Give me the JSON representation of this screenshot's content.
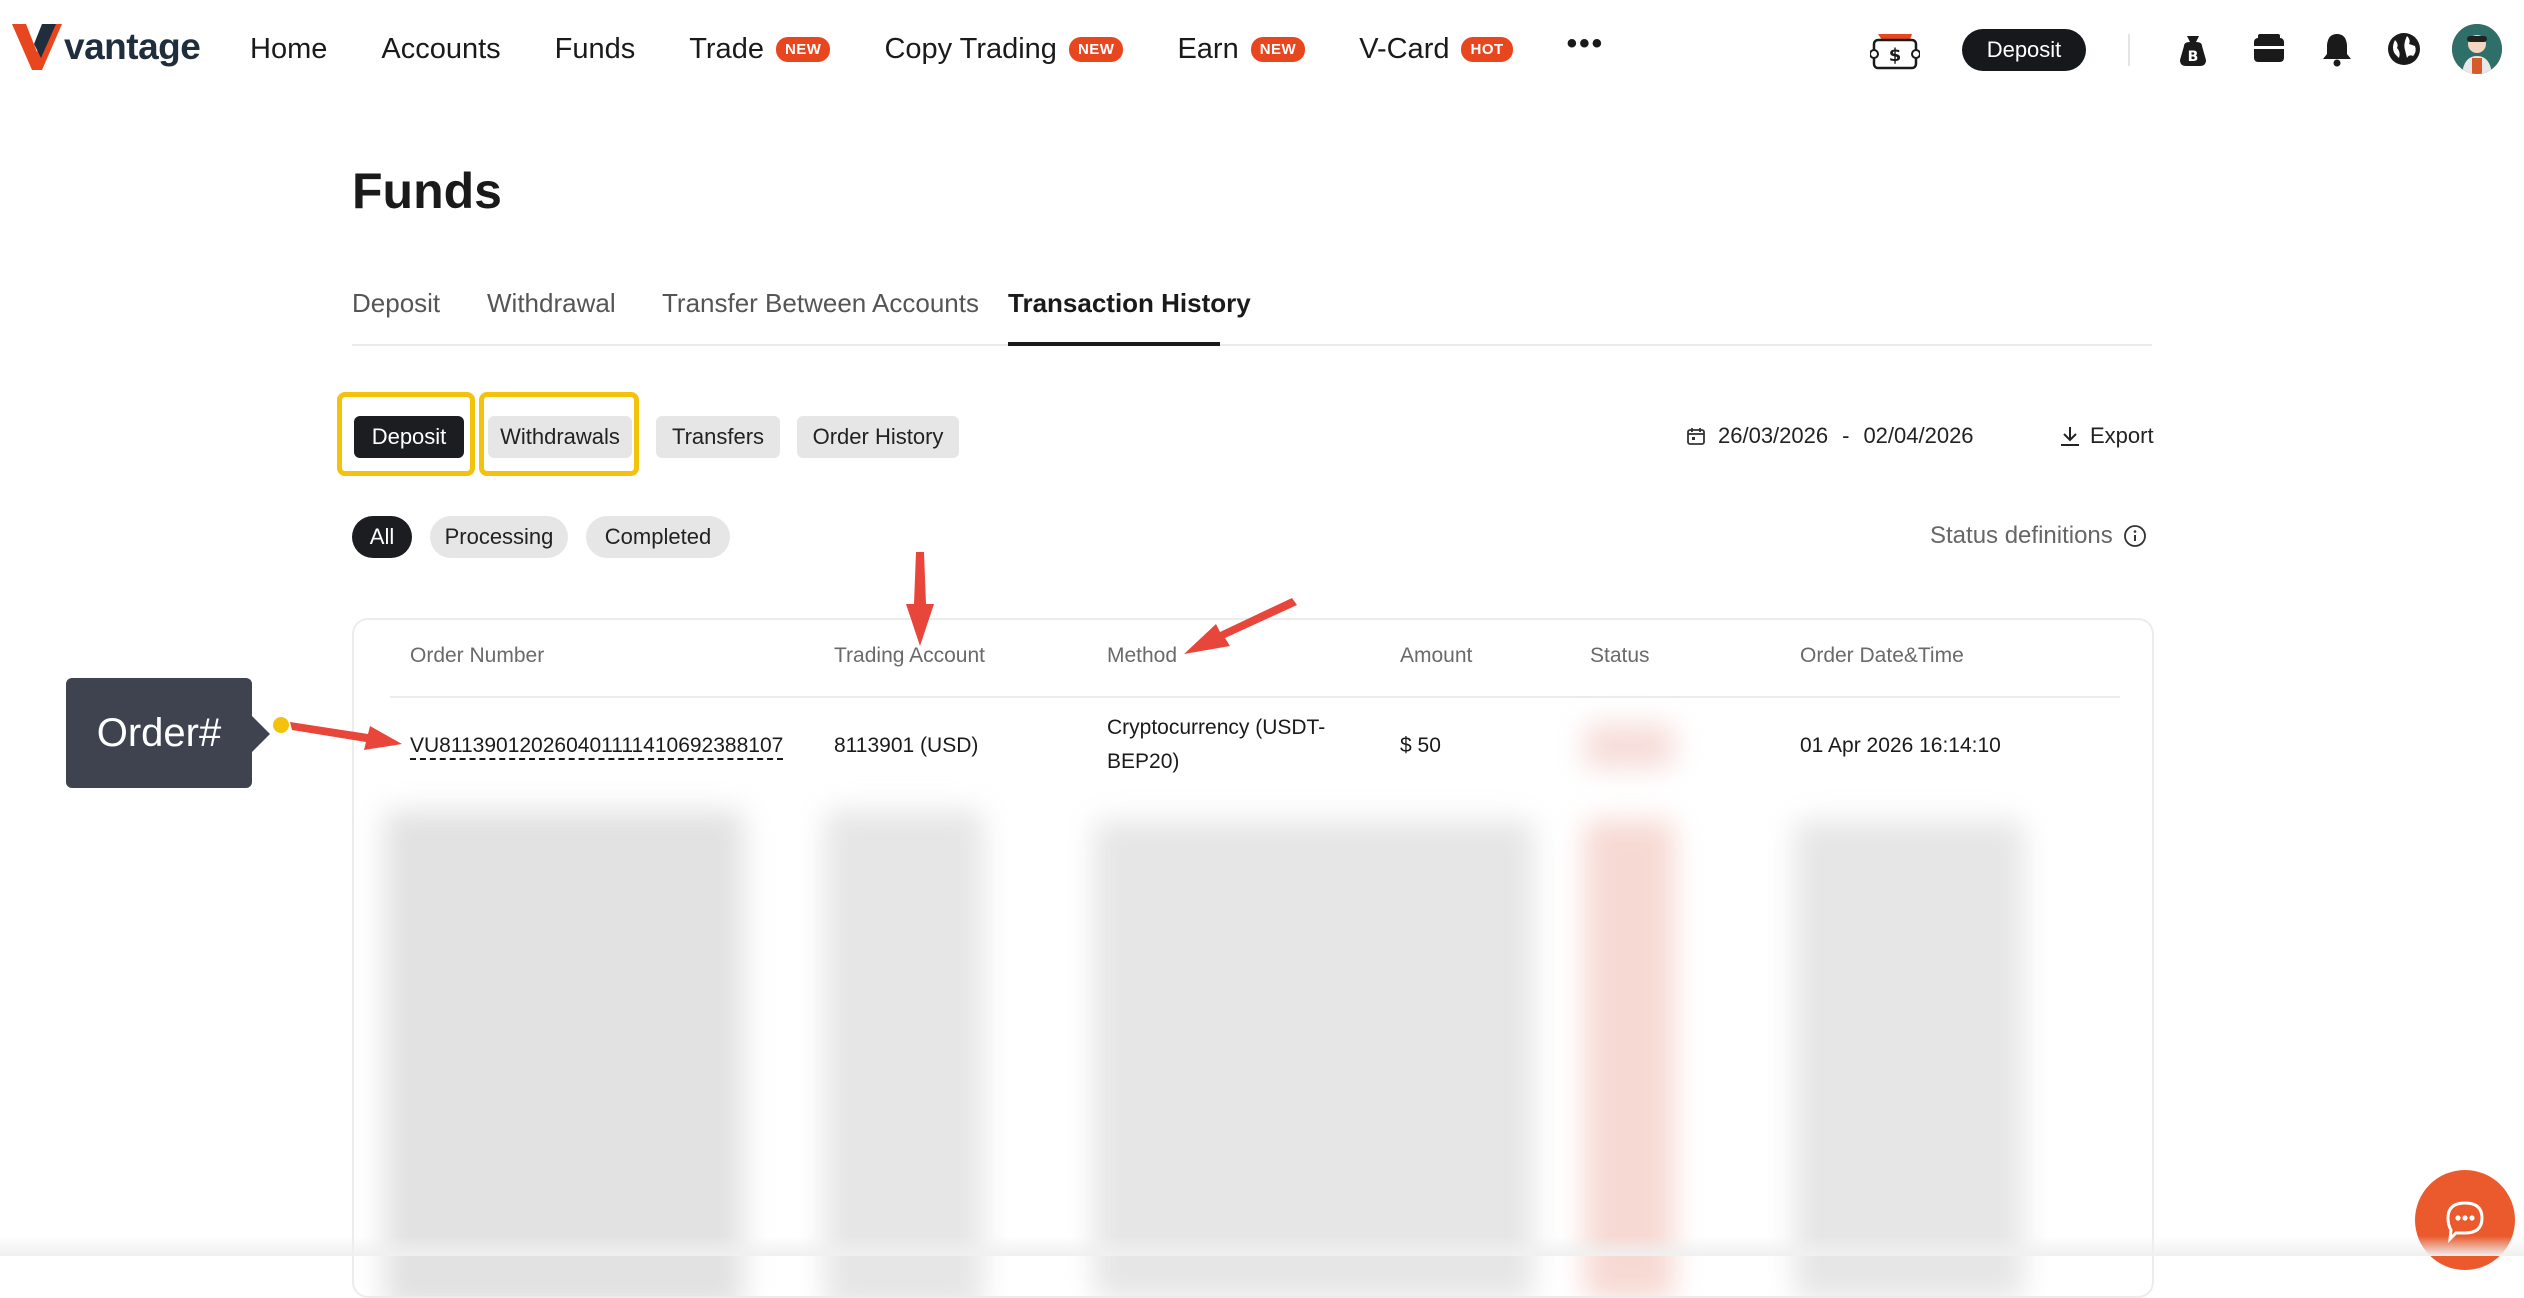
{
  "nav": {
    "logo_text": "vantage",
    "items": [
      {
        "label": "Home",
        "badge": ""
      },
      {
        "label": "Accounts",
        "badge": ""
      },
      {
        "label": "Funds",
        "badge": ""
      },
      {
        "label": "Trade",
        "badge": "NEW"
      },
      {
        "label": "Copy Trading",
        "badge": "NEW"
      },
      {
        "label": "Earn",
        "badge": "NEW"
      },
      {
        "label": "V-Card",
        "badge": "HOT"
      }
    ],
    "more": "•••",
    "deposit_label": "Deposit",
    "icons": [
      "voucher-icon",
      "bitcoin-bag-icon",
      "wallet-icon",
      "bell-icon",
      "globe-icon",
      "avatar"
    ]
  },
  "page": {
    "title": "Funds",
    "tabs": [
      "Deposit",
      "Withdrawal",
      "Transfer Between Accounts",
      "Transaction History"
    ],
    "active_tab": "Transaction History"
  },
  "filters": {
    "types": [
      "Deposit",
      "Withdrawals",
      "Transfers",
      "Order History"
    ],
    "active_type": "Deposit",
    "date_from": "26/03/2026",
    "date_sep": "-",
    "date_to": "02/04/2026",
    "export_label": "Export",
    "statuses": [
      "All",
      "Processing",
      "Completed"
    ],
    "active_status": "All",
    "status_definitions_label": "Status definitions"
  },
  "table": {
    "columns": [
      "Order Number",
      "Trading Account",
      "Method",
      "Amount",
      "Status",
      "Order Date&Time"
    ],
    "rows": [
      {
        "order_number": "VU8113901202604011114106923881​07",
        "trading_account": "8113901 (USD)",
        "method_line1": "Cryptocurrency (USDT-",
        "method_line2": "BEP20)",
        "amount": "$ 50",
        "status": "",
        "datetime": "01 Apr 2026 16:14:10"
      }
    ]
  },
  "annotation": {
    "callout_label": "Order#",
    "highlight_color": "#f4c20d",
    "arrow_color": "#e8463a"
  },
  "colors": {
    "accent": "#e8461e",
    "dark_button": "#1c1d21",
    "chat": "#ea5a2c"
  }
}
